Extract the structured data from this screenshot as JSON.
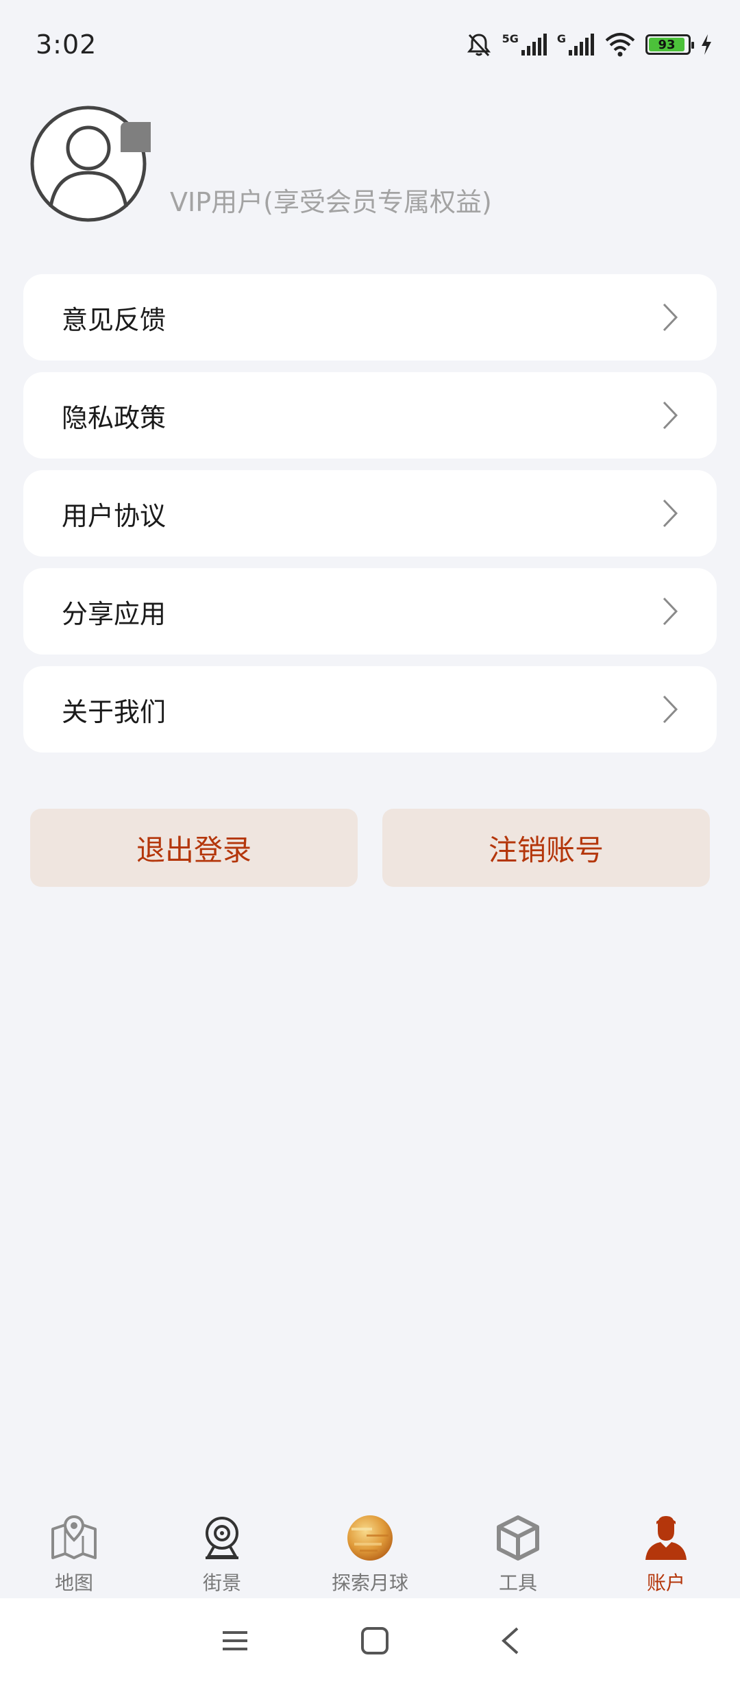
{
  "status_bar": {
    "time": "3:02",
    "network_label": "5G",
    "network_label_2": "G",
    "battery_level": "93",
    "battery_fraction": 0.93
  },
  "profile": {
    "vip_text": "VIP用户(享受会员专属权益)"
  },
  "menu": {
    "items": [
      {
        "label": "意见反馈"
      },
      {
        "label": "隐私政策"
      },
      {
        "label": "用户协议"
      },
      {
        "label": "分享应用"
      },
      {
        "label": "关于我们"
      }
    ]
  },
  "actions": {
    "logout_label": "退出登录",
    "cancel_account_label": "注销账号"
  },
  "tabs": [
    {
      "label": "地图",
      "icon": "map-icon"
    },
    {
      "label": "街景",
      "icon": "webcam-icon"
    },
    {
      "label": "探索月球",
      "icon": "moon-icon"
    },
    {
      "label": "工具",
      "icon": "cube-icon"
    },
    {
      "label": "账户",
      "icon": "person-icon"
    }
  ],
  "colors": {
    "accent": "#b4360b",
    "button_bg": "#efe5df",
    "page_bg": "#f3f4f8",
    "card_bg": "#ffffff"
  }
}
